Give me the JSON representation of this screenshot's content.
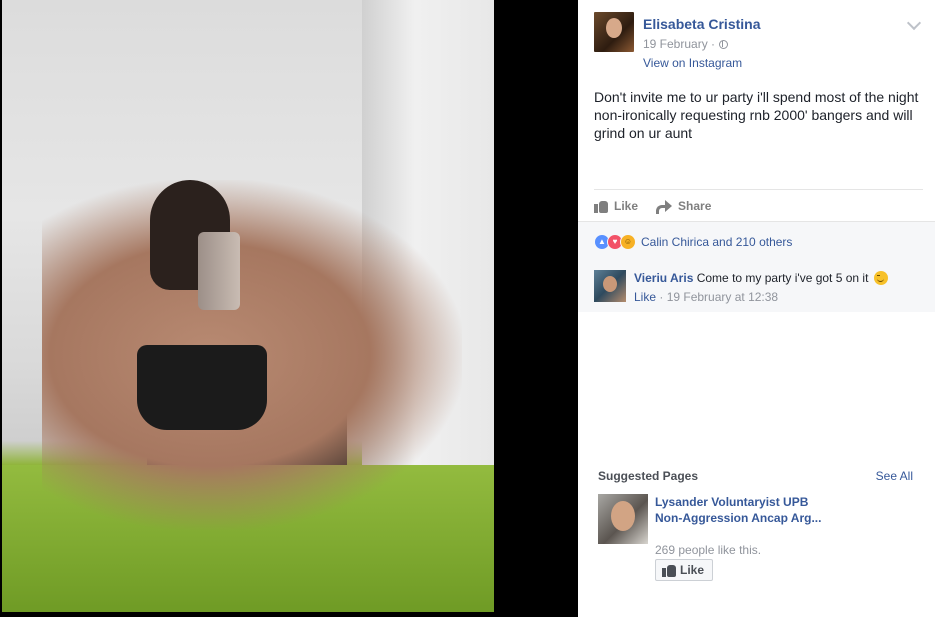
{
  "post": {
    "author": "Elisabeta Cristina",
    "date": "19 February ·",
    "instagram_link": "View on Instagram",
    "text": "Don't invite me to ur party i'll spend most of the night non-ironically requesting rnb 2000' bangers and will grind on ur aunt"
  },
  "actions": {
    "like_label": "Like",
    "share_label": "Share"
  },
  "reactions": {
    "summary": "Calin Chirica and 210 others",
    "types": [
      "like",
      "love",
      "haha"
    ]
  },
  "comment": {
    "author": "Vieriu Aris",
    "text": "Come to my party i've got 5 on it",
    "like_label": "Like",
    "timestamp": "· 19 February at 12:38"
  },
  "suggested": {
    "title": "Suggested Pages",
    "see_all": "See All",
    "page_name": "Lysander Voluntaryist UPB Non-Aggression Ancap Arg...",
    "likes": "269 people like this.",
    "like_button": "Like"
  },
  "colors": {
    "link": "#365899",
    "text": "#1d2129",
    "muted": "#90949c",
    "comments_bg": "#f6f7f9"
  }
}
